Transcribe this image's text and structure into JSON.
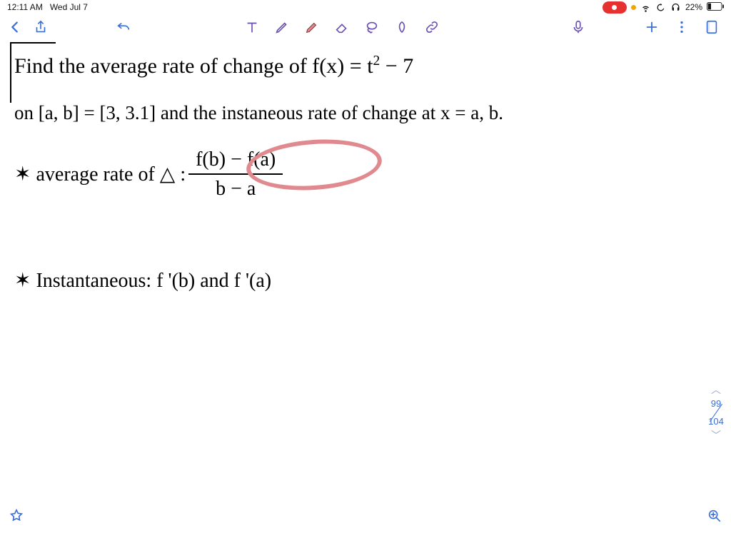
{
  "status": {
    "time": "12:11 AM",
    "date": "Wed Jul 7",
    "battery": "22%"
  },
  "toolbar": {
    "back": "Back",
    "share": "Share",
    "undo": "Undo",
    "text_tool": "Text",
    "pencil": "Pencil",
    "highlighter": "Highlighter",
    "eraser": "Eraser",
    "lasso": "Lasso",
    "shape": "Shapes",
    "attach": "Link",
    "mic": "Microphone",
    "add": "Add",
    "more": "More",
    "pages": "Page view"
  },
  "notes": {
    "line1_a": "Find the average rate of change of f(x) = t",
    "line1_exp": "2",
    "line1_b": " − 7",
    "line2": "on [a, b] = [3, 3.1] and the instaneous rate of change at x = a, b.",
    "line3_label": "✶ average rate of △ :",
    "frac_num": "f(b) − f(a)",
    "frac_den": "b − a",
    "line4": "✶ Instantaneous:  f '(b)  and  f '(a)"
  },
  "page": {
    "current": "99",
    "total": "104"
  },
  "icons": {
    "star": "star-icon",
    "zoom_in": "zoom-in-icon",
    "wifi": "wifi-icon",
    "orientation": "orientation-lock-icon",
    "headphones": "headphones-icon",
    "battery": "battery-icon"
  }
}
